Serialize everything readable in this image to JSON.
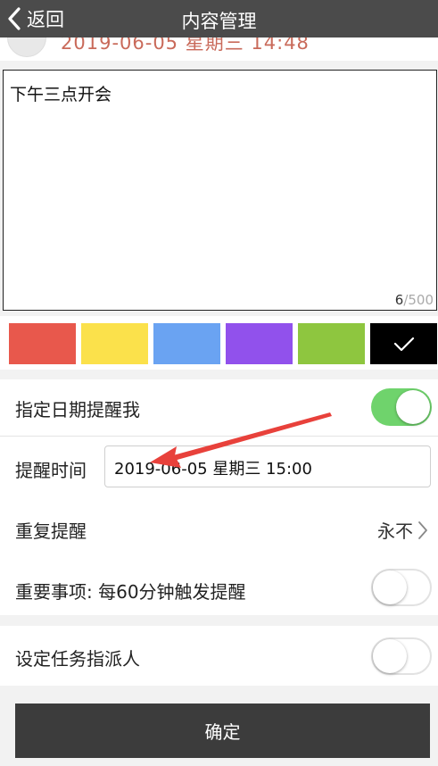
{
  "nav": {
    "back_label": "返回",
    "title": "内容管理"
  },
  "behind": {
    "timestamp": "2019-06-05 星期三 14:48"
  },
  "editor": {
    "content": "下午三点开会",
    "count": "6",
    "max": "/500"
  },
  "colors": {
    "swatches": [
      "#e8584c",
      "#fbe14b",
      "#6aa3f2",
      "#9151ec",
      "#8ec63f",
      "#000000"
    ],
    "selected_index": 5,
    "selected_icon": "checkmark-icon"
  },
  "date_reminder": {
    "label": "指定日期提醒我",
    "enabled": true
  },
  "remind_time": {
    "label": "提醒时间",
    "value": "2019-06-05 星期三 15:00"
  },
  "repeat": {
    "label": "重复提醒",
    "value": "永不",
    "icon": "chevron-right-icon"
  },
  "important": {
    "label": "重要事项: 每60分钟触发提醒",
    "enabled": false
  },
  "assignee": {
    "label": "设定任务指派人",
    "enabled": false
  },
  "confirm": {
    "label": "确定"
  },
  "annotation": {
    "color": "#e8413b",
    "icon": "red-arrow-annotation"
  }
}
